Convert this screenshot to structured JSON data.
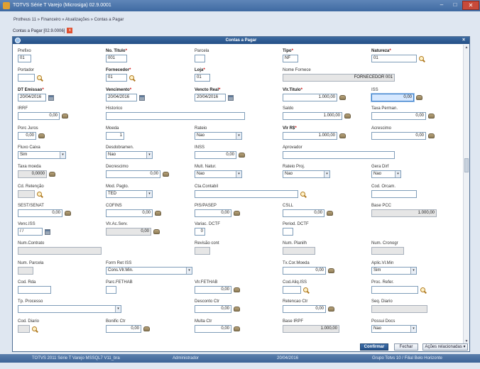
{
  "window": {
    "title": "TOTVS Série T Varejo (Microsiga) 02.9.0001"
  },
  "breadcrumb": "Protheus 11 » Financeiro » Atualizações » Contas a Pagar",
  "tab": {
    "label": "Contas a Pagar [02.9.0006]",
    "close": "x"
  },
  "dialog": {
    "title": "Contas a Pagar",
    "close": "×"
  },
  "fields": [
    {
      "label": "Prefixo",
      "value": "01"
    },
    {
      "label": "No. Titulo",
      "value": "001"
    },
    {
      "label": "Parcela",
      "value": ""
    },
    {
      "label": "Tipo",
      "value": "NF"
    },
    {
      "label": "Natureza",
      "value": "01"
    },
    {
      "label": "Portador",
      "value": ""
    },
    {
      "label": "Fornecedor",
      "value": "01"
    },
    {
      "label": "Loja",
      "value": "01"
    },
    {
      "label": "Nome Fornece",
      "value": "FORNECEDOR 001"
    },
    {
      "label": "DT Emissao",
      "value": "20/04/2016"
    },
    {
      "label": "Vencimento",
      "value": "20/04/2016"
    },
    {
      "label": "Vencto Real",
      "value": "20/04/2016"
    },
    {
      "label": "Vlr.Titulo",
      "value": "1.000,00"
    },
    {
      "label": "ISS",
      "value": "0,00"
    },
    {
      "label": "IRRF",
      "value": "0,00"
    },
    {
      "label": "Historico",
      "value": ""
    },
    {
      "label": "Saldo",
      "value": "1.000,00"
    },
    {
      "label": "Taxa Perman.",
      "value": "0,00"
    },
    {
      "label": "Porc Juros",
      "value": "0,00"
    },
    {
      "label": "Moeda",
      "value": "1"
    },
    {
      "label": "Rateio",
      "value": "Nao"
    },
    {
      "label": "Vlr R$",
      "value": "1.000,00"
    },
    {
      "label": "Acrescimo",
      "value": "0,00"
    },
    {
      "label": "Fluxo Caixa",
      "value": "Sim"
    },
    {
      "label": "Desdobramen.",
      "value": "Nao"
    },
    {
      "label": "INSS",
      "value": "0,00"
    },
    {
      "label": "Aprovador",
      "value": ""
    },
    {
      "label": "Taxa moeda",
      "value": "0,0000"
    },
    {
      "label": "Decrescimo",
      "value": "0,00"
    },
    {
      "label": "Mult. Natur.",
      "value": "Nao"
    },
    {
      "label": "Rateio Proj.",
      "value": "Nao"
    },
    {
      "label": "Gera Dirf",
      "value": "Nao"
    },
    {
      "label": "Cd. Retenção",
      "value": ""
    },
    {
      "label": "Mod. Pagto.",
      "value": "TED"
    },
    {
      "label": "Cta.Contabil",
      "value": ""
    },
    {
      "label": "Cod. Orcam.",
      "value": ""
    },
    {
      "label": "SEST/SENAT",
      "value": "0,00"
    },
    {
      "label": "COFINS",
      "value": "0,00"
    },
    {
      "label": "PIS/PASEP",
      "value": "0,00"
    },
    {
      "label": "CSLL",
      "value": "0,00"
    },
    {
      "label": "Base PCC",
      "value": "1.000,00"
    },
    {
      "label": "Venc.ISS",
      "value": "  /  /"
    },
    {
      "label": "Vlr.Ac.Serv.",
      "value": "0,00"
    },
    {
      "label": "Variac. DCTF",
      "value": "0"
    },
    {
      "label": "Period. DCTF",
      "value": ""
    },
    {
      "label": "Num.Contrato",
      "value": ""
    },
    {
      "label": "Revisão cont",
      "value": ""
    },
    {
      "label": "Num. Planilh",
      "value": ""
    },
    {
      "label": "Num. Cronogr",
      "value": ""
    },
    {
      "label": "Num. Parcela",
      "value": ""
    },
    {
      "label": "Form Ret ISS",
      "value": "Cons.Vlr.Min."
    },
    {
      "label": "Tx.Cor.Moeda",
      "value": "0,00"
    },
    {
      "label": "Aplic.Vl.Min",
      "value": "Sim"
    },
    {
      "label": "Cod. Rda",
      "value": ""
    },
    {
      "label": "Parc.FETHAB",
      "value": ""
    },
    {
      "label": "Vlr.FETHAB",
      "value": "0,00"
    },
    {
      "label": "Cod.Aliq.ISS",
      "value": ""
    },
    {
      "label": "Proc. Refer.",
      "value": ""
    },
    {
      "label": "Tp. Processo",
      "value": ""
    },
    {
      "label": "Desconto Ctr",
      "value": "0,00"
    },
    {
      "label": "Retencao Ctr",
      "value": "0,00"
    },
    {
      "label": "Seq. Diario",
      "value": ""
    },
    {
      "label": "Cod. Diario",
      "value": ""
    },
    {
      "label": "Bonific Ctr",
      "value": "0,00"
    },
    {
      "label": "Multa Ctr",
      "value": "0,00"
    },
    {
      "label": "Base IRPF",
      "value": "1.000,00"
    },
    {
      "label": "Possui Docs",
      "value": "Nao"
    }
  ],
  "buttons": {
    "confirm": "Confirmar",
    "close": "Fechar",
    "actions": "Ações relacionadas"
  },
  "status": {
    "product": "TOTVS 2011 Série T Varejo MSSQL7 V11_bra",
    "user": "Administrador",
    "date": "20/04/2016",
    "company": "Grupo Totvs 10 / Filial Belo Horizonte"
  },
  "colors": {
    "title_bar": "#3f6aa2",
    "dialog_header": "#234f86",
    "required_star": "#cc0000",
    "focus_field": "#d6e8ff"
  }
}
